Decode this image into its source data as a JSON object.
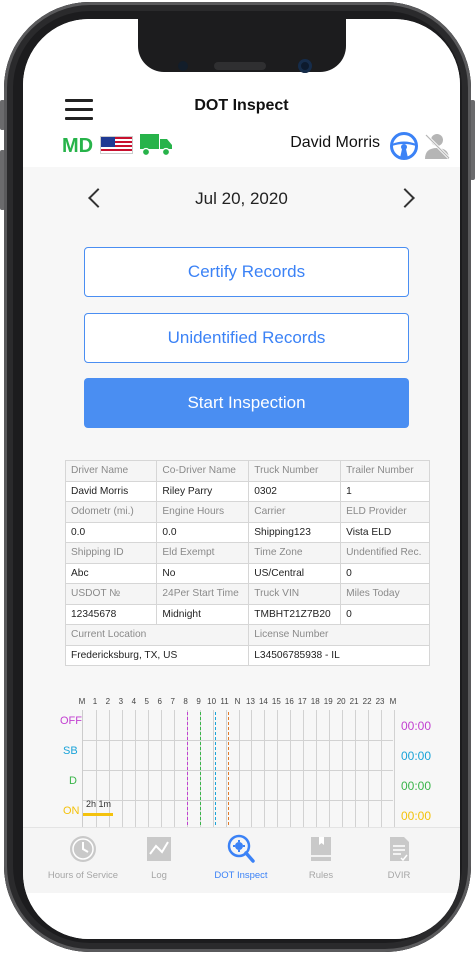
{
  "header": {
    "title": "DOT Inspect",
    "state_code": "MD",
    "driver_name": "David Morris",
    "icons": [
      "menu-icon",
      "us-flag-icon",
      "truck-icon",
      "steering-wheel-icon",
      "co-driver-icon"
    ],
    "state_color": "#27b34a"
  },
  "date_nav": {
    "date": "Jul 20, 2020"
  },
  "buttons": {
    "certify": "Certify Records",
    "unidentified": "Unidentified Records",
    "start_inspection": "Start Inspection"
  },
  "info_table": {
    "rows": [
      {
        "labels": [
          "Driver Name",
          "Co-Driver Name",
          "Truck Number",
          "Trailer Number"
        ],
        "values": [
          "David Morris",
          "Riley Parry",
          "0302",
          "1"
        ]
      },
      {
        "labels": [
          "Odometr (mi.)",
          "Engine Hours",
          "Carrier",
          "ELD Provider"
        ],
        "values": [
          "0.0",
          "0.0",
          "Shipping123",
          "Vista ELD"
        ]
      },
      {
        "labels": [
          "Shipping ID",
          "Eld Exempt",
          "Time Zone",
          "Undentified Rec."
        ],
        "values": [
          "Abc",
          "No",
          "US/Central",
          "0"
        ]
      },
      {
        "labels": [
          "USDOT №",
          "24Per Start Time",
          "Truck VIN",
          "Miles Today"
        ],
        "values": [
          "12345678",
          "Midnight",
          "TMBHT21Z7B20",
          "0"
        ]
      }
    ],
    "last_row": {
      "labels": [
        "Current Location",
        "License Number"
      ],
      "values": [
        "Fredericksburg, TX, US",
        "L34506785938 - IL"
      ]
    }
  },
  "log_graph": {
    "hour_labels": [
      "M",
      "1",
      "2",
      "3",
      "4",
      "5",
      "6",
      "7",
      "8",
      "9",
      "10",
      "11",
      "N",
      "13",
      "14",
      "15",
      "16",
      "17",
      "18",
      "19",
      "20",
      "21",
      "22",
      "23",
      "M"
    ],
    "statuses": [
      {
        "label": "OFF",
        "time": "00:00",
        "color": "#c23fd1"
      },
      {
        "label": "SB",
        "time": "00:00",
        "color": "#1aa3d9"
      },
      {
        "label": "D",
        "time": "00:00",
        "color": "#3ab54a"
      },
      {
        "label": "ON",
        "time": "00:00",
        "color": "#f4c20d"
      }
    ],
    "on_duty_total": "2h 1m",
    "event_colors": [
      "#c23fd1",
      "#3ab54a",
      "#1aa3d9",
      "#e07b2a"
    ]
  },
  "tabbar": {
    "tabs": [
      {
        "label": "Hours of Service",
        "icon": "clock-icon"
      },
      {
        "label": "Log",
        "icon": "log-graph-icon"
      },
      {
        "label": "DOT Inspect",
        "icon": "dot-inspect-icon"
      },
      {
        "label": "Rules",
        "icon": "book-icon"
      },
      {
        "label": "DVIR",
        "icon": "document-icon"
      }
    ],
    "active_tab": "DOT Inspect",
    "active_color": "#3b82f6"
  }
}
